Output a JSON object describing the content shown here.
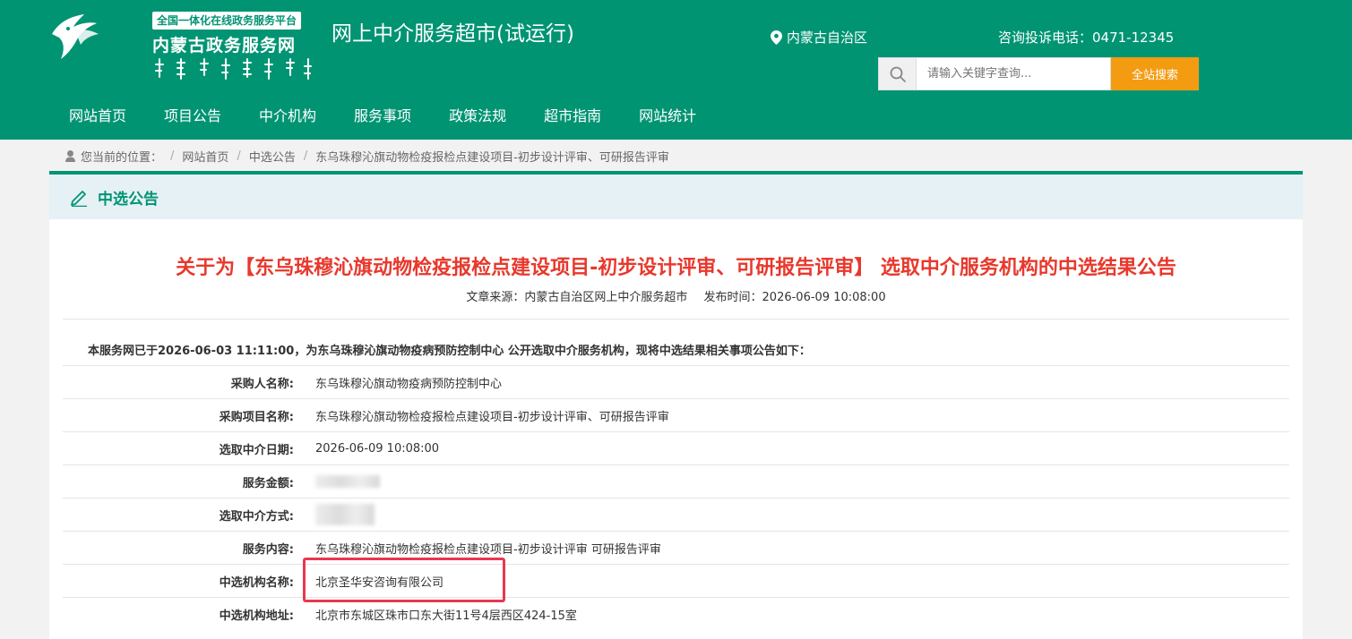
{
  "header": {
    "platform_tag": "全国一体化在线政务服务平台",
    "portal_name": "内蒙古政务服务网",
    "site_title": "网上中介服务超市(试运行)",
    "region": "内蒙古自治区",
    "hotline": "咨询投诉电话：0471-12345",
    "search_placeholder": "请输入关键字查询...",
    "search_button": "全站搜索",
    "brand_color": "#009473",
    "accent_color": "#f39c12"
  },
  "nav": [
    "网站首页",
    "项目公告",
    "中介机构",
    "服务事项",
    "政策法规",
    "超市指南",
    "网站统计"
  ],
  "breadcrumb": {
    "prefix": "您当前的位置：",
    "items": [
      "网站首页",
      "中选公告",
      "东乌珠穆沁旗动物检疫报检点建设项目-初步设计评审、可研报告评审"
    ]
  },
  "panel": {
    "title": "中选公告",
    "article_title": "关于为【东乌珠穆沁旗动物检疫报检点建设项目-初步设计评审、可研报告评审】 选取中介服务机构的中选结果公告",
    "source": "文章来源：内蒙古自治区网上中介服务超市",
    "published": "发布时间：2026-06-09 10:08:00",
    "intro": "本服务网已于2026-06-03 11:11:00，为东乌珠穆沁旗动物疫病预防控制中心 公开选取中介服务机构，现将中选结果相关事项公告如下：",
    "title_color": "#e8382c"
  },
  "details": [
    {
      "label": "采购人名称:",
      "value": "东乌珠穆沁旗动物疫病预防控制中心"
    },
    {
      "label": "采购项目名称:",
      "value": "东乌珠穆沁旗动物检疫报检点建设项目-初步设计评审、可研报告评审"
    },
    {
      "label": "选取中介日期:",
      "value": "2026-06-09 10:08:00"
    },
    {
      "label": "服务金额:",
      "value": ""
    },
    {
      "label": "选取中介方式:",
      "value": ""
    },
    {
      "label": "服务内容:",
      "value": "东乌珠穆沁旗动物检疫报检点建设项目-初步设计评审 可研报告评审"
    },
    {
      "label": "中选机构名称:",
      "value": "北京圣华安咨询有限公司"
    },
    {
      "label": "中选机构地址:",
      "value": "北京市东城区珠市口东大街11号4层西区424-15室"
    }
  ]
}
